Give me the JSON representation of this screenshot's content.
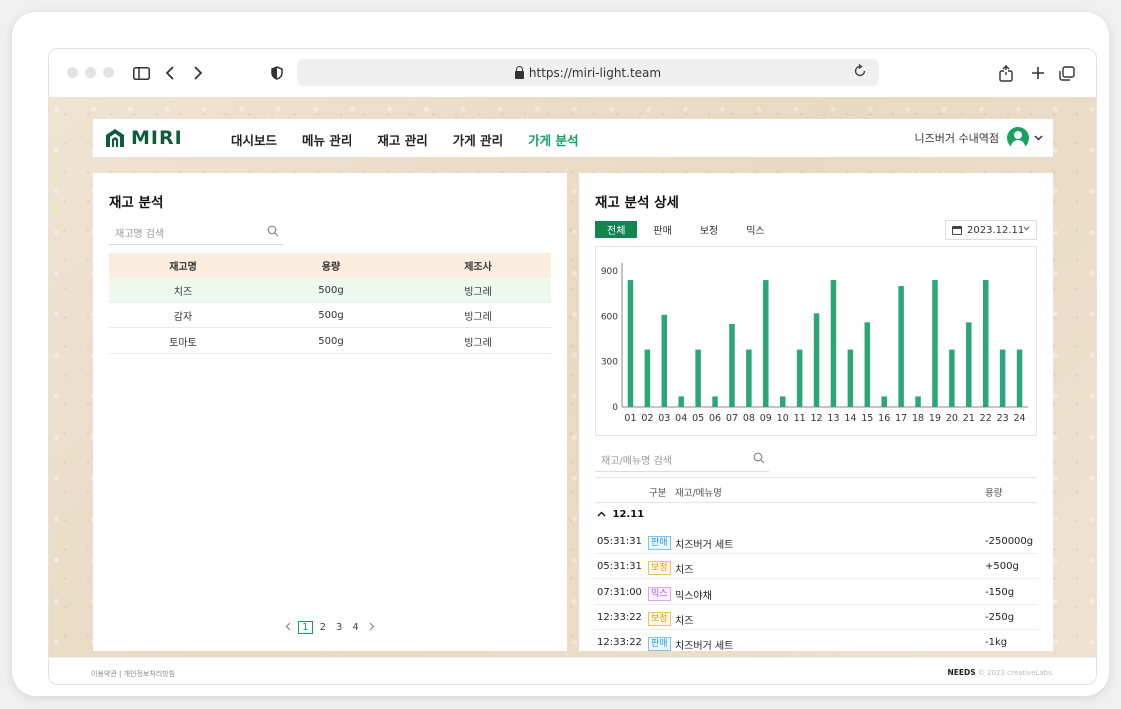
{
  "browser": {
    "url": "https://miri-light.team"
  },
  "nav": {
    "logo": "MIRI",
    "menu": [
      {
        "label": "대시보드"
      },
      {
        "label": "메뉴 관리"
      },
      {
        "label": "재고 관리"
      },
      {
        "label": "가게 관리"
      },
      {
        "label": "가게 분석"
      }
    ],
    "active_index": 4,
    "store_name": "니즈버거 수내역점"
  },
  "left": {
    "title": "재고 분석",
    "search_placeholder": "재고명 검색",
    "columns": [
      "재고명",
      "용량",
      "제조사"
    ],
    "rows": [
      {
        "name": "치즈",
        "size": "500g",
        "maker": "빙그레"
      },
      {
        "name": "감자",
        "size": "500g",
        "maker": "빙그레"
      },
      {
        "name": "토마토",
        "size": "500g",
        "maker": "빙그레"
      }
    ],
    "pages": [
      "1",
      "2",
      "3",
      "4"
    ],
    "current_page": "1"
  },
  "right": {
    "title": "재고 분석 상세",
    "tabs": [
      "전체",
      "판매",
      "보정",
      "믹스"
    ],
    "active_tab": "전체",
    "date": "2023.12.11",
    "search_placeholder": "재고/메뉴명 검색",
    "log_columns": {
      "type": "구분",
      "name": "재고/메뉴명",
      "amount": "용량"
    },
    "group_label": "12.11",
    "logs": [
      {
        "time": "05:31:31",
        "type": "판매",
        "name": "치즈버거 세트",
        "amount": "-250000g"
      },
      {
        "time": "05:31:31",
        "type": "보정",
        "name": "치즈",
        "amount": "+500g"
      },
      {
        "time": "07:31:00",
        "type": "믹스",
        "name": "믹스야채",
        "amount": "-150g"
      },
      {
        "time": "12:33:22",
        "type": "보정",
        "name": "치즈",
        "amount": "-250g"
      },
      {
        "time": "12:33:22",
        "type": "판매",
        "name": "치즈버거 세트",
        "amount": "-1kg"
      }
    ]
  },
  "chart_data": {
    "type": "bar",
    "categories": [
      "01",
      "02",
      "03",
      "04",
      "05",
      "06",
      "07",
      "08",
      "09",
      "10",
      "11",
      "12",
      "13",
      "14",
      "15",
      "16",
      "17",
      "18",
      "19",
      "20",
      "21",
      "22",
      "23",
      "24"
    ],
    "values": [
      840,
      380,
      610,
      70,
      380,
      70,
      550,
      380,
      840,
      70,
      380,
      620,
      840,
      380,
      560,
      70,
      800,
      70,
      840,
      380,
      560,
      840,
      380,
      380
    ],
    "yticks": [
      0,
      300,
      600,
      900
    ],
    "ylim": [
      0,
      900
    ],
    "color": "#2aa774"
  },
  "footer": {
    "left": "이용약관 | 개인정보처리방침",
    "brand": "NEEDS",
    "copyright": "© 2023 creativeLabs."
  }
}
